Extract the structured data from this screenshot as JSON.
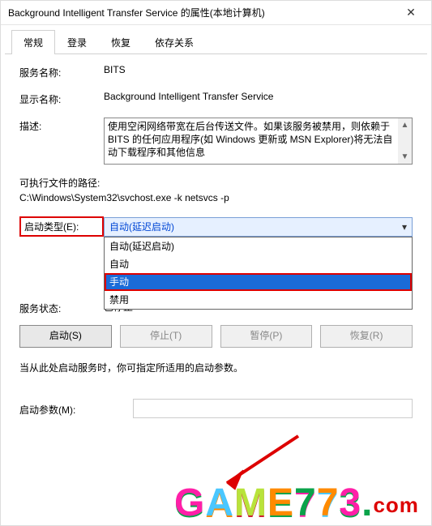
{
  "title": "Background Intelligent Transfer Service 的属性(本地计算机)",
  "tabs": {
    "general": "常规",
    "logon": "登录",
    "recovery": "恢复",
    "deps": "依存关系"
  },
  "labels": {
    "service_name": "服务名称:",
    "display_name": "显示名称:",
    "description": "描述:",
    "path_caption": "可执行文件的路径:",
    "startup_type": "启动类型(E):",
    "status": "服务状态:",
    "param_note": "当从此处启动服务时，你可指定所适用的启动参数。",
    "start_param": "启动参数(M):"
  },
  "values": {
    "service_name": "BITS",
    "display_name": "Background Intelligent Transfer Service",
    "description": "使用空闲网络带宽在后台传送文件。如果该服务被禁用，则依赖于 BITS 的任何应用程序(如 Windows 更新或 MSN Explorer)将无法自动下载程序和其他信息",
    "path": "C:\\Windows\\System32\\svchost.exe -k netsvcs -p",
    "startup_selected": "自动(延迟启动)",
    "status_value": "已停止"
  },
  "dropdown_options": {
    "auto_delayed": "自动(延迟启动)",
    "auto": "自动",
    "manual": "手动",
    "disabled": "禁用"
  },
  "buttons": {
    "start": "启动(S)",
    "stop": "停止(T)",
    "pause": "暂停(P)",
    "resume": "恢复(R)"
  },
  "watermark": {
    "g": "G",
    "a": "A",
    "m": "M",
    "e": "E",
    "n7a": "7",
    "n7b": "7",
    "n3": "3",
    "dot": ".",
    "com": "com"
  }
}
